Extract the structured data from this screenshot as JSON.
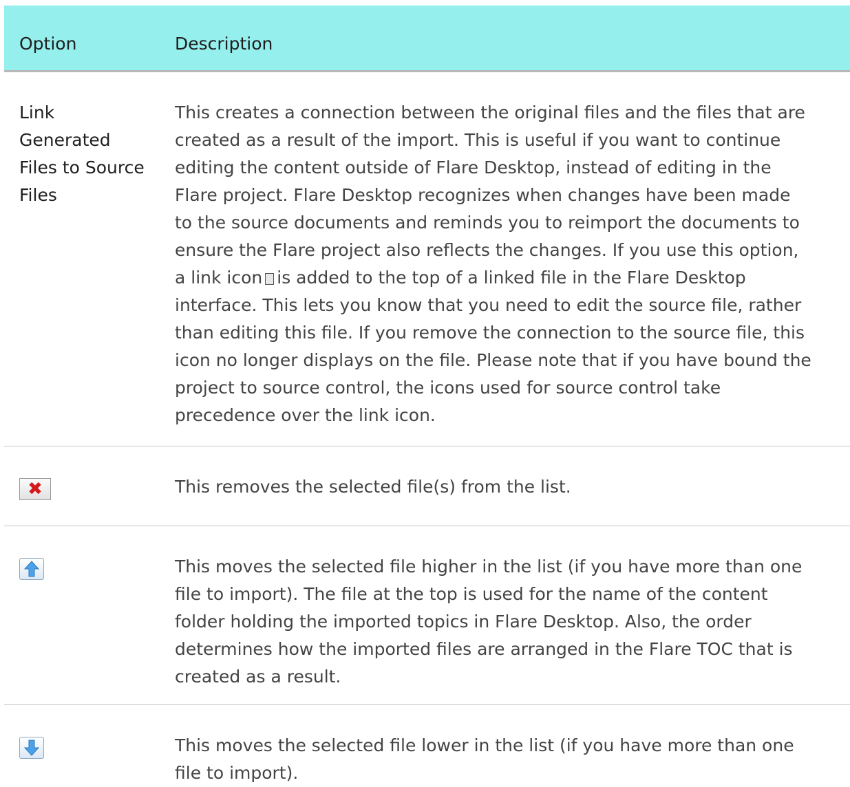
{
  "header": {
    "option": "Option",
    "description": "Description"
  },
  "rows": [
    {
      "option": "Link Generated Files to Source Files",
      "description_lines": [
        "This creates a connection between the original files and the files that are",
        "created as a result of the import. This is useful if you want to continue",
        "editing the content outside of Flare Desktop, instead of editing in the",
        "Flare project. Flare Desktop recognizes when changes have been made",
        "to the source documents and reminds you to reimport the documents to",
        "ensure the Flare project also reflects the changes. If you use this option,"
      ],
      "line_link_prefix": "a link icon",
      "line_link_suffix": "is added to the top of a linked file in the Flare Desktop",
      "description_lines_2": [
        "interface. This lets you know that you need to edit the source file, rather",
        "than editing this file. If you remove the connection to the source file, this",
        "icon no longer displays on the file. Please note that if you have bound the",
        "project to source control, the icons used for source control take",
        "precedence over the link icon."
      ]
    },
    {
      "icon": "delete-x-icon",
      "description_lines": [
        "This removes the selected file(s) from the list."
      ]
    },
    {
      "icon": "arrow-up-icon",
      "description_lines": [
        "This moves the selected file higher in the list (if you have more than one",
        "file to import). The file at the top is used for the name of the content",
        "folder holding the imported topics in Flare Desktop. Also, the order",
        "determines how the imported files are arranged in the Flare TOC that is",
        "created as a result."
      ]
    },
    {
      "icon": "arrow-down-icon",
      "description_lines": [
        "This moves the selected file lower in the list (if you have more than one",
        "file to import)."
      ]
    }
  ],
  "colors": {
    "header_bg": "#95efec",
    "delete_red": "#d2191c",
    "arrow_blue": "#3b8fd9"
  }
}
